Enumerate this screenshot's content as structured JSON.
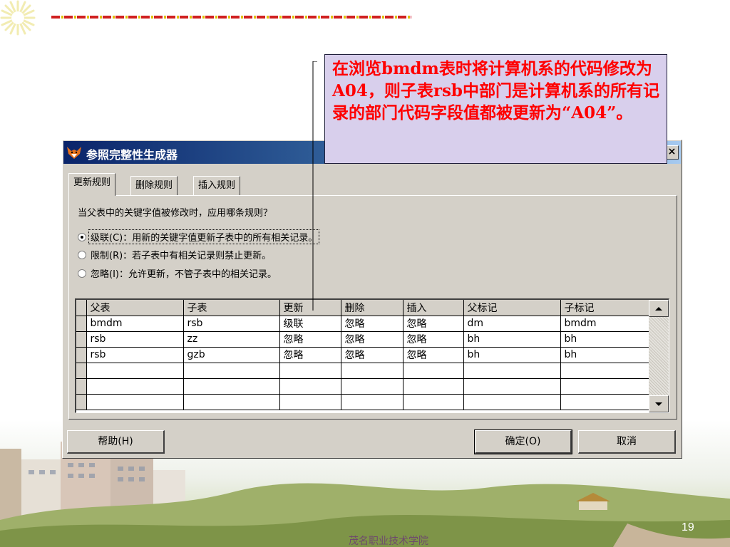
{
  "dialog": {
    "title": "参照完整性生成器",
    "close_label": "×",
    "tabs": [
      {
        "label": "更新规则"
      },
      {
        "label": "删除规则"
      },
      {
        "label": "插入规则"
      }
    ],
    "question": "当父表中的关键字值被修改时，应用哪条规则？",
    "options": [
      {
        "label": "级联(C)：用新的关键字值更新子表中的所有相关记录。",
        "selected": true
      },
      {
        "label": "限制(R)：若子表中有相关记录则禁止更新。",
        "selected": false
      },
      {
        "label": "忽略(I)：允许更新，不管子表中的相关记录。",
        "selected": false
      }
    ],
    "grid": {
      "columns": [
        "父表",
        "子表",
        "更新",
        "删除",
        "插入",
        "父标记",
        "子标记"
      ],
      "rows": [
        [
          "bmdm",
          "rsb",
          "级联",
          "忽略",
          "忽略",
          "dm",
          "bmdm"
        ],
        [
          "rsb",
          "zz",
          "忽略",
          "忽略",
          "忽略",
          "bh",
          "bh"
        ],
        [
          "rsb",
          "gzb",
          "忽略",
          "忽略",
          "忽略",
          "bh",
          "bh"
        ]
      ]
    },
    "help_label": "帮助(H)",
    "ok_label": "确定(O)",
    "cancel_label": "取消"
  },
  "callout": {
    "text": "在浏览bmdm表时将计算机系的代码修改为A04，则子表rsb中部门是计算机系的所有记录的部门代码字段值都被更新为“A04”。"
  },
  "footer": {
    "school": "茂名职业技术学院",
    "page_number": "19"
  },
  "colors": {
    "callout_text": "#ff0000",
    "callout_bg": "#d8cfec",
    "titlebar_start": "#0a246a",
    "dash_red": "#d02020",
    "dash_yellow": "#e0c000"
  }
}
